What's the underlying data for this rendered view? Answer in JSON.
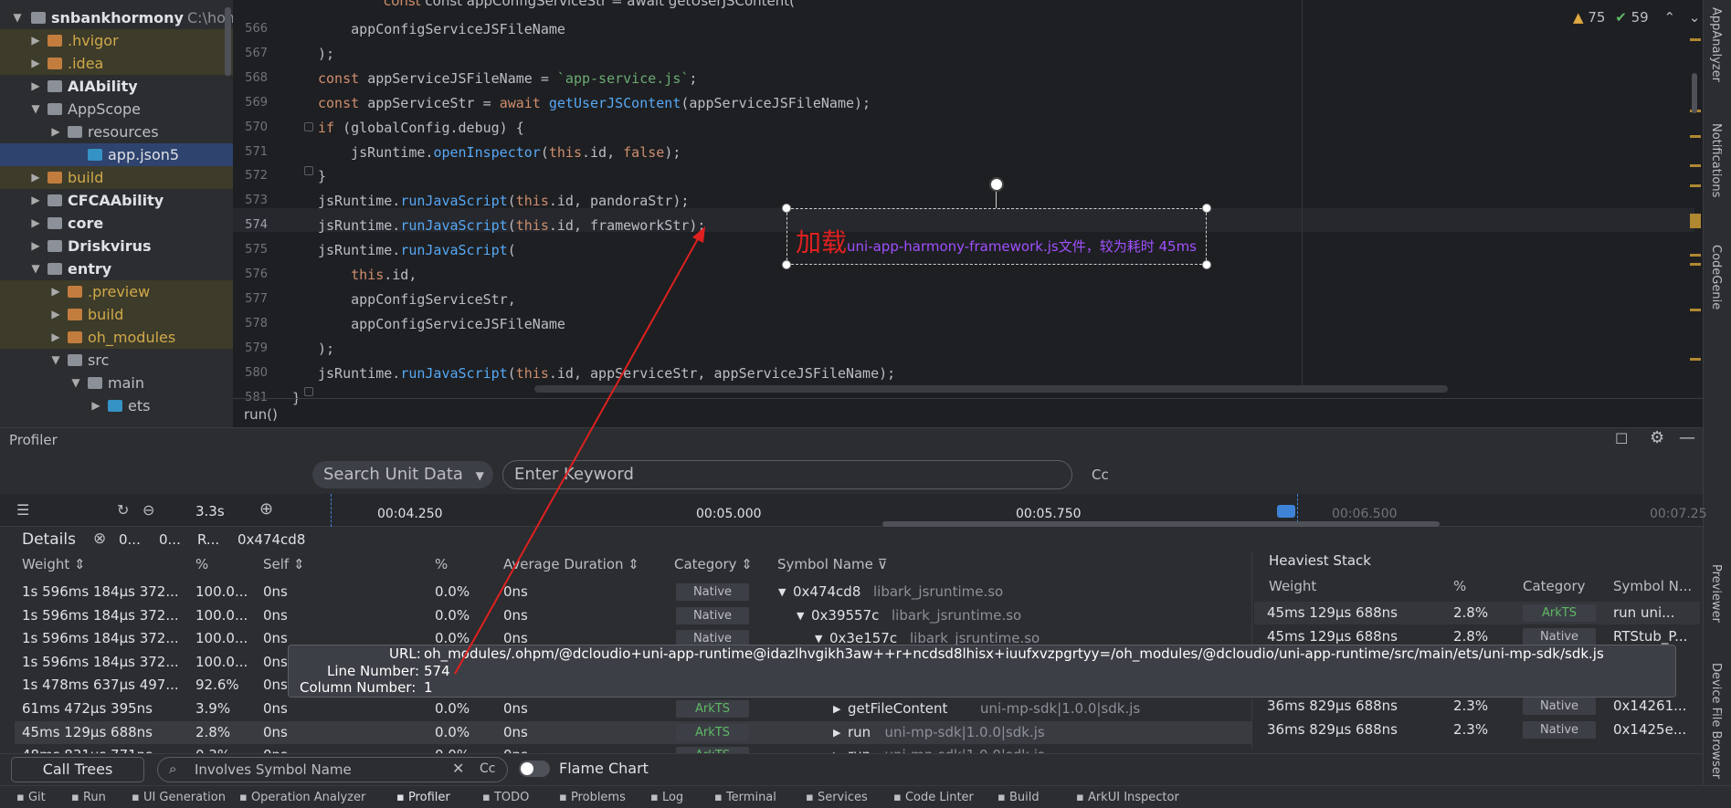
{
  "project": {
    "root_label": "snbankhormony",
    "root_path": "C:\\home\\",
    "items": [
      {
        "label": ".hvigor",
        "style": "yel"
      },
      {
        "label": ".idea",
        "style": "yel"
      },
      {
        "label": "AIAbility",
        "style": "bold"
      },
      {
        "label": "AppScope",
        "style": "normal"
      },
      {
        "label": "resources",
        "style": "normal"
      },
      {
        "label": "app.json5",
        "style": "sel"
      },
      {
        "label": "build",
        "style": "yel"
      },
      {
        "label": "CFCAAbility",
        "style": "bold"
      },
      {
        "label": "core",
        "style": "bold"
      },
      {
        "label": "Driskvirus",
        "style": "bold"
      },
      {
        "label": "entry",
        "style": "bold"
      },
      {
        "label": ".preview",
        "style": "yel"
      },
      {
        "label": "build",
        "style": "yel"
      },
      {
        "label": "oh_modules",
        "style": "yel"
      },
      {
        "label": "src",
        "style": "normal"
      },
      {
        "label": "main",
        "style": "normal"
      },
      {
        "label": "ets",
        "style": "normal"
      }
    ]
  },
  "editor": {
    "line_numbers": [
      "566",
      "567",
      "568",
      "569",
      "570",
      "571",
      "572",
      "573",
      "574",
      "575",
      "576",
      "577",
      "578",
      "579",
      "580",
      "581"
    ],
    "top_partial": "const appConfigServiceStr = await getUserJSContent(",
    "lines": [
      [
        {
          "t": "    appConfigServiceJSFileName",
          "c": "plain"
        }
      ],
      [
        {
          "t": ");",
          "c": "plain"
        }
      ],
      [
        {
          "t": "const ",
          "c": "kw"
        },
        {
          "t": "appServiceJSFileName = ",
          "c": "plain"
        },
        {
          "t": "`app-service.js`",
          "c": "str"
        },
        {
          "t": ";",
          "c": "plain"
        }
      ],
      [
        {
          "t": "const ",
          "c": "kw"
        },
        {
          "t": "appServiceStr = ",
          "c": "plain"
        },
        {
          "t": "await ",
          "c": "kw"
        },
        {
          "t": "getUserJSContent",
          "c": "fn"
        },
        {
          "t": "(appServiceJSFileName);",
          "c": "plain"
        }
      ],
      [
        {
          "t": "if ",
          "c": "kw"
        },
        {
          "t": "(globalConfig.debug) {",
          "c": "plain"
        }
      ],
      [
        {
          "t": "    jsRuntime.",
          "c": "plain"
        },
        {
          "t": "openInspector",
          "c": "fn"
        },
        {
          "t": "(",
          "c": "plain"
        },
        {
          "t": "this",
          "c": "kw"
        },
        {
          "t": ".id, ",
          "c": "plain"
        },
        {
          "t": "false",
          "c": "kw"
        },
        {
          "t": ");",
          "c": "plain"
        }
      ],
      [
        {
          "t": "}",
          "c": "plain"
        }
      ],
      [
        {
          "t": "jsRuntime.",
          "c": "plain"
        },
        {
          "t": "runJavaScript",
          "c": "fn"
        },
        {
          "t": "(",
          "c": "plain"
        },
        {
          "t": "this",
          "c": "kw"
        },
        {
          "t": ".id, pandoraStr);",
          "c": "plain"
        }
      ],
      [
        {
          "t": "jsRuntime.",
          "c": "plain"
        },
        {
          "t": "runJavaScript",
          "c": "fn"
        },
        {
          "t": "(",
          "c": "plain"
        },
        {
          "t": "this",
          "c": "kw"
        },
        {
          "t": ".id, frameworkStr);",
          "c": "plain"
        }
      ],
      [
        {
          "t": "jsRuntime.",
          "c": "plain"
        },
        {
          "t": "runJavaScript",
          "c": "fn"
        },
        {
          "t": "(",
          "c": "plain"
        }
      ],
      [
        {
          "t": "    ",
          "c": "plain"
        },
        {
          "t": "this",
          "c": "kw"
        },
        {
          "t": ".id,",
          "c": "plain"
        }
      ],
      [
        {
          "t": "    appConfigServiceStr,",
          "c": "plain"
        }
      ],
      [
        {
          "t": "    appConfigServiceJSFileName",
          "c": "plain"
        }
      ],
      [
        {
          "t": ");",
          "c": "plain"
        }
      ],
      [
        {
          "t": "jsRuntime.",
          "c": "plain"
        },
        {
          "t": "runJavaScript",
          "c": "fn"
        },
        {
          "t": "(",
          "c": "plain"
        },
        {
          "t": "this",
          "c": "kw"
        },
        {
          "t": ".id, appServiceStr, appServiceJSFileName);",
          "c": "plain"
        }
      ],
      [
        {
          "t": "}",
          "c": "plain"
        }
      ]
    ],
    "breadcrumb": "run()",
    "warnings": "75",
    "weak_warnings": "59"
  },
  "annotation": {
    "big": "加载",
    "small": "uni-app-harmony-framework.js文件，较为耗时  45ms"
  },
  "right_sidebar": [
    "AppAnalyzer",
    "Notifications",
    "CodeGenie",
    "Previewer",
    "Device File Browser"
  ],
  "profiler": {
    "title": "Profiler",
    "search_mode": "Search Unit Data",
    "keyword_placeholder": "Enter Keyword",
    "cc": "Cc",
    "duration": "3.3s",
    "ticks": [
      "00:04.250",
      "00:05.000",
      "00:05.750",
      "00:06.500",
      "00:07.25"
    ],
    "details_label": "Details",
    "details_crumbs": [
      "0...",
      "0...",
      "R...",
      "0x474cd8"
    ],
    "columns": [
      "Weight",
      "%",
      "Self",
      "%",
      "Average Duration",
      "Category",
      "Symbol Name"
    ],
    "rows": [
      {
        "weight": "1s 596ms 184μs 372...",
        "pct": "100.0...",
        "self": "0ns",
        "spct": "0.0%",
        "avg": "0ns",
        "cat": "Native",
        "sym": "0x474cd8",
        "lib": "libark_jsruntime.so",
        "indent": 0,
        "open": true
      },
      {
        "weight": "1s 596ms 184μs 372...",
        "pct": "100.0...",
        "self": "0ns",
        "spct": "0.0%",
        "avg": "0ns",
        "cat": "Native",
        "sym": "0x39557c",
        "lib": "libark_jsruntime.so",
        "indent": 1,
        "open": true
      },
      {
        "weight": "1s 596ms 184μs 372...",
        "pct": "100.0...",
        "self": "0ns",
        "spct": "0.0%",
        "avg": "0ns",
        "cat": "Native",
        "sym": "0x3e157c",
        "lib": "libark_jsruntime.so",
        "indent": 2,
        "open": true
      },
      {
        "weight": "1s 596ms 184μs 372...",
        "pct": "100.0...",
        "self": "0ns",
        "spct": "0.0%",
        "avg": "0ns",
        "cat": "",
        "sym": "",
        "lib": "",
        "indent": 3,
        "open": true
      },
      {
        "weight": "1s 478ms 637μs 497...",
        "pct": "92.6%",
        "self": "0ns",
        "spct": "0.0%",
        "avg": "0ns",
        "cat": "",
        "sym": "",
        "lib": "",
        "indent": 3,
        "open": true
      },
      {
        "weight": "61ms 472μs 395ns",
        "pct": "3.9%",
        "self": "0ns",
        "spct": "0.0%",
        "avg": "0ns",
        "cat": "ArkTS",
        "sym": "getFileContent",
        "lib": "uni-mp-sdk|1.0.0|sdk.js",
        "indent": 3,
        "open": false
      },
      {
        "weight": "45ms 129μs 688ns",
        "pct": "2.8%",
        "self": "0ns",
        "spct": "0.0%",
        "avg": "0ns",
        "cat": "ArkTS",
        "sym": "run",
        "lib": "uni-mp-sdk|1.0.0|sdk.js",
        "indent": 3,
        "open": false
      },
      {
        "weight": "48ms 831μs 771ns",
        "pct": "0.3%",
        "self": "0ns",
        "spct": "0.0%",
        "avg": "0ns",
        "cat": "ArkTS",
        "sym": "run",
        "lib": "uni-mp-sdk|1.0.0|sdk.js",
        "indent": 3,
        "open": false
      }
    ],
    "heaviest": {
      "title": "Heaviest Stack",
      "columns": [
        "Weight",
        "%",
        "Category",
        "Symbol N..."
      ],
      "rows": [
        {
          "weight": "45ms 129μs 688ns",
          "pct": "2.8%",
          "cat": "ArkTS",
          "sym": "run  uni..."
        },
        {
          "weight": "45ms 129μs 688ns",
          "pct": "2.8%",
          "cat": "Native",
          "sym": "RTStub_P..."
        },
        {
          "weight": "",
          "pct": "",
          "cat": "",
          "sym": ""
        },
        {
          "weight": "36ms 829μs 688ns",
          "pct": "2.3%",
          "cat": "Native",
          "sym": "OH_JSV..."
        },
        {
          "weight": "36ms 829μs 688ns",
          "pct": "2.3%",
          "cat": "Native",
          "sym": "0x14261..."
        },
        {
          "weight": "36ms 829μs 688ns",
          "pct": "2.3%",
          "cat": "Native",
          "sym": "0x1425e..."
        }
      ]
    },
    "tooltip": {
      "url_label": "URL:",
      "url": "oh_modules/.ohpm/@dcloudio+uni-app-runtime@idazlhvgikh3aw++r+ncdsd8lhisx+iuufxvzpgrtyy=/oh_modules/@dcloudio/uni-app-runtime/src/main/ets/uni-mp-sdk/sdk.js",
      "line_label": "Line Number:",
      "line": "574",
      "col_label": "Column Number:",
      "col": "1"
    },
    "call_trees": "Call Trees",
    "filter_placeholder": "Involves Symbol Name",
    "flame": "Flame Chart"
  },
  "toolbar": [
    "Git",
    "Run",
    "UI Generation",
    "Operation Analyzer",
    "Profiler",
    "TODO",
    "Problems",
    "Log",
    "Terminal",
    "Services",
    "Code Linter",
    "Build",
    "ArkUI Inspector"
  ]
}
